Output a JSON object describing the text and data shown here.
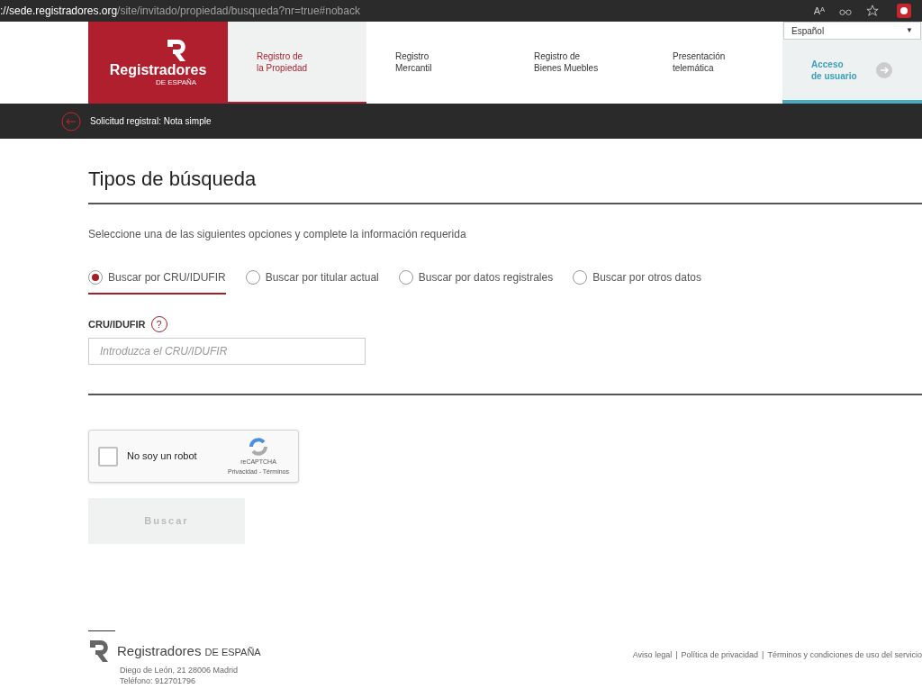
{
  "browser": {
    "url_host": "://sede.registradores.org",
    "url_path": "/site/invitado/propiedad/busqueda?nr=true#noback",
    "read_aloud": "Aᴬ"
  },
  "header": {
    "logo": {
      "name": "Registradores",
      "sub": "DE ESPAÑA"
    },
    "nav": [
      {
        "label": "Registro de\nla Propiedad",
        "selected": true
      },
      {
        "label": "Registro\nMercantil",
        "selected": false
      },
      {
        "label": "Registro de\nBienes Muebles",
        "selected": false
      },
      {
        "label": "Presentación\ntelemática",
        "selected": false
      }
    ],
    "language": "Español",
    "language_caret": "▼",
    "access": "Acceso\nde usuario"
  },
  "breadcrumb": "Solicitud registral: Nota simple",
  "title": "Tipos de búsqueda",
  "intro": "Seleccione una de las siguientes opciones y complete la información requerida",
  "options": [
    {
      "label": "Buscar por CRU/IDUFIR",
      "selected": true
    },
    {
      "label": "Buscar por titular actual",
      "selected": false
    },
    {
      "label": "Buscar por datos registrales",
      "selected": false
    },
    {
      "label": "Buscar por otros datos",
      "selected": false
    }
  ],
  "field": {
    "label": "CRU/IDUFIR",
    "help": "?",
    "placeholder": "Introduzca el CRU/IDUFIR"
  },
  "captcha": {
    "label": "No soy un robot",
    "checked": false,
    "brand": "reCAPTCHA",
    "links": "Privacidad - Términos"
  },
  "submit": {
    "label": "Buscar",
    "disabled": true
  },
  "footer": {
    "name": "Registradores",
    "sub": "DE ESPAÑA",
    "address": "Diego de León, 21 28006 Madrid",
    "phone": "Teléfono: 912701796",
    "separator": "|",
    "links": [
      "Aviso legal",
      "Política de privacidad",
      "Términos y condiciones de uso del servicio"
    ]
  }
}
